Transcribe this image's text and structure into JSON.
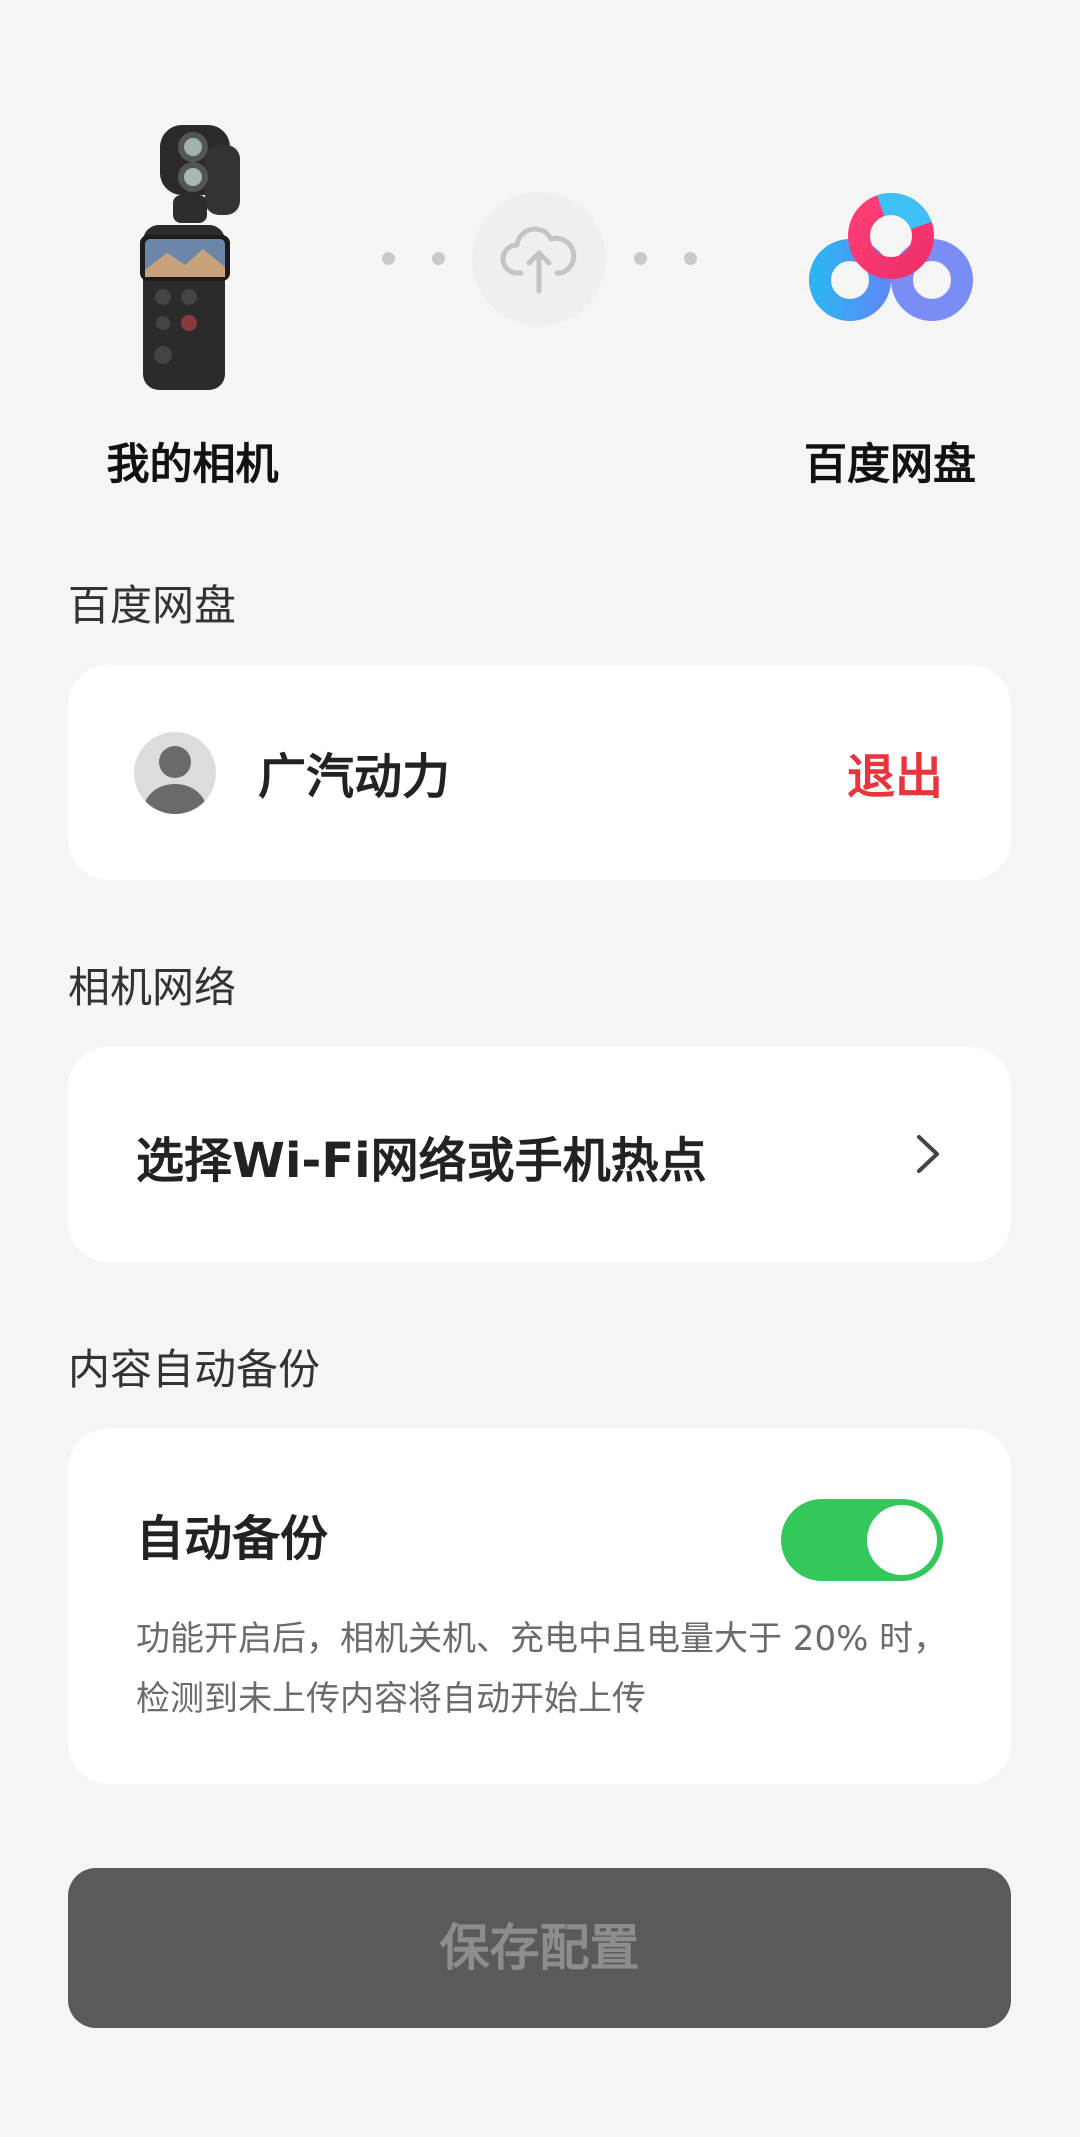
{
  "header": {
    "camera_label": "我的相机",
    "cloud_label": "百度网盘",
    "camera_icon": "action-camera-icon",
    "upload_icon": "cloud-upload-icon",
    "cloud_logo": "baidu-netdisk-logo"
  },
  "cloud_section": {
    "title": "百度网盘",
    "account_name": "广汽动力",
    "logout_label": "退出"
  },
  "network_section": {
    "title": "相机网络",
    "select_label": "选择Wi-Fi网络或手机热点"
  },
  "backup_section": {
    "title": "内容自动备份",
    "toggle_label": "自动备份",
    "toggle_on": true,
    "description": "功能开启后，相机关机、充电中且电量大于 20% 时，检测到未上传内容将自动开始上传"
  },
  "save_button_label": "保存配置",
  "colors": {
    "accent_red": "#e8353b",
    "toggle_green": "#34c759",
    "save_disabled_bg": "#5a5a5c",
    "background": "#f5f5f5"
  }
}
